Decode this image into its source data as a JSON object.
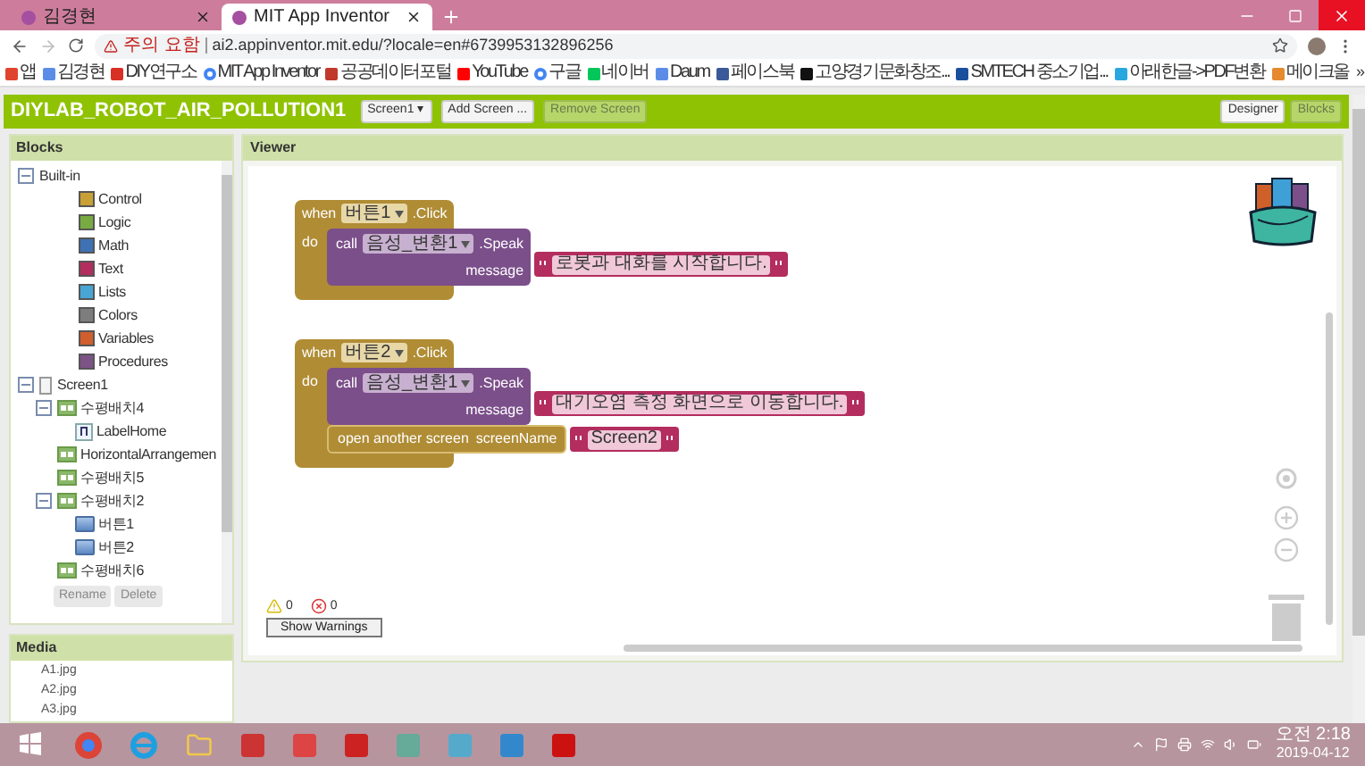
{
  "browser": {
    "tabs": [
      {
        "title": "김경현",
        "selected": false
      },
      {
        "title": "MIT App Inventor",
        "selected": true
      }
    ],
    "address": {
      "warning": "주의 요함",
      "url": "ai2.appinventor.mit.edu/?locale=en#6739953132896256"
    },
    "bookmarks": [
      {
        "label": "앱",
        "kind": "apps",
        "color": "#e0442e"
      },
      {
        "label": "김경현",
        "kind": "site",
        "color": "#5b8de8"
      },
      {
        "label": "DIY연구소",
        "kind": "site",
        "color": "#d93025"
      },
      {
        "label": "MIT App Inventor",
        "kind": "google",
        "color": "#4285f4"
      },
      {
        "label": "공공데이터포털",
        "kind": "site",
        "color": "#c0392b"
      },
      {
        "label": "YouTube",
        "kind": "site",
        "color": "#ff0000"
      },
      {
        "label": "구글",
        "kind": "google",
        "color": "#4285f4"
      },
      {
        "label": "네이버",
        "kind": "site",
        "color": "#03c75a"
      },
      {
        "label": "Daum",
        "kind": "site",
        "color": "#5b8de8"
      },
      {
        "label": "페이스북",
        "kind": "site",
        "color": "#3b5998"
      },
      {
        "label": "고양경기문화창조...",
        "kind": "site",
        "color": "#111111"
      },
      {
        "label": "SMTECH 중소기업...",
        "kind": "site",
        "color": "#1a4f9c"
      },
      {
        "label": "아래한글->PDF변환",
        "kind": "site",
        "color": "#29a8e0"
      },
      {
        "label": "메이크올",
        "kind": "site",
        "color": "#e58a2e"
      }
    ],
    "more": "»"
  },
  "app_bar": {
    "project": "DIYLAB_ROBOT_AIR_POLLUTION1",
    "screen_buttons": [
      {
        "label": "Screen1 ▾",
        "disabled": false
      },
      {
        "label": "Add Screen ...",
        "disabled": false
      },
      {
        "label": "Remove Screen",
        "disabled": true
      }
    ],
    "view_buttons": [
      {
        "label": "Designer",
        "selected": false
      },
      {
        "label": "Blocks",
        "selected": true
      }
    ]
  },
  "blocks_panel": {
    "title": "Blocks",
    "tree": [
      {
        "label": "Built-in",
        "kind": "folder",
        "expanded": true,
        "children": [
          {
            "label": "Control",
            "kind": "category",
            "color": "#c8a036"
          },
          {
            "label": "Logic",
            "kind": "category",
            "color": "#77ab41"
          },
          {
            "label": "Math",
            "kind": "category",
            "color": "#3f71b5"
          },
          {
            "label": "Text",
            "kind": "category",
            "color": "#b32d5e"
          },
          {
            "label": "Lists",
            "kind": "category",
            "color": "#49a6d4"
          },
          {
            "label": "Colors",
            "kind": "category",
            "color": "#7d7d7d"
          },
          {
            "label": "Variables",
            "kind": "category",
            "color": "#d05f2d"
          },
          {
            "label": "Procedures",
            "kind": "category",
            "color": "#7c5385"
          }
        ]
      },
      {
        "label": "Screen1",
        "kind": "screen",
        "expanded": true,
        "children": [
          {
            "label": "수평배치4",
            "kind": "arrangement",
            "expanded": true,
            "children": [
              {
                "label": "LabelHome",
                "kind": "label"
              }
            ]
          },
          {
            "label": "HorizontalArrangemen",
            "kind": "arrangement"
          },
          {
            "label": "수평배치5",
            "kind": "arrangement"
          },
          {
            "label": "수평배치2",
            "kind": "arrangement",
            "expanded": true,
            "children": [
              {
                "label": "버튼1",
                "kind": "button"
              },
              {
                "label": "버튼2",
                "kind": "button"
              }
            ]
          },
          {
            "label": "수평배치6",
            "kind": "arrangement"
          }
        ]
      }
    ],
    "buttons": [
      "Rename",
      "Delete"
    ]
  },
  "media_panel": {
    "title": "Media",
    "files": [
      "A1.jpg",
      "A2.jpg",
      "A3.jpg"
    ]
  },
  "viewer": {
    "title": "Viewer",
    "blocks": [
      {
        "when": "when",
        "component": "버튼1",
        "event": ".Click",
        "do": "do",
        "statements": [
          {
            "kind": "call",
            "keyword": "call",
            "component": "음성_변환1",
            "method": ".Speak",
            "param": "message",
            "value": "로봇과 대화를 시작합니다."
          }
        ]
      },
      {
        "when": "when",
        "component": "버튼2",
        "event": ".Click",
        "do": "do",
        "statements": [
          {
            "kind": "call",
            "keyword": "call",
            "component": "음성_변환1",
            "method": ".Speak",
            "param": "message",
            "value": "대기오염 측정 화면으로 이동합니다."
          },
          {
            "kind": "open_screen",
            "keyword": "open another screen",
            "param": "screenName",
            "value": "Screen2"
          }
        ]
      }
    ],
    "warnings": {
      "warning_count": "0",
      "error_count": "0",
      "button": "Show Warnings"
    }
  },
  "taskbar": {
    "time": "오전 2:18",
    "date": "2019-04-12"
  }
}
